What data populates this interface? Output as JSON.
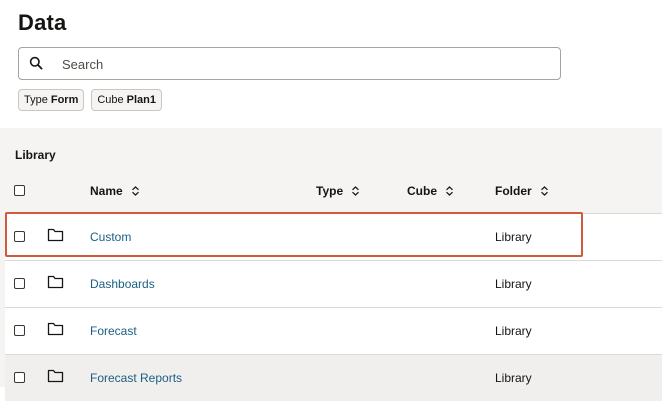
{
  "header": {
    "title": "Data",
    "search": {
      "placeholder": "Search",
      "value": ""
    },
    "filters": [
      {
        "key": "Type",
        "value": "Form"
      },
      {
        "key": "Cube",
        "value": "Plan1"
      }
    ]
  },
  "list": {
    "section_label": "Library",
    "columns": {
      "name": "Name",
      "type": "Type",
      "cube": "Cube",
      "folder": "Folder"
    },
    "rows": [
      {
        "name": "Custom",
        "type": "",
        "cube": "",
        "folder": "Library",
        "icon": "folder-icon"
      },
      {
        "name": "Dashboards",
        "type": "",
        "cube": "",
        "folder": "Library",
        "icon": "folder-icon"
      },
      {
        "name": "Forecast",
        "type": "",
        "cube": "",
        "folder": "Library",
        "icon": "folder-icon"
      },
      {
        "name": "Forecast Reports",
        "type": "",
        "cube": "",
        "folder": "Library",
        "icon": "folder-icon"
      }
    ]
  },
  "colors": {
    "link": "#1a5f83",
    "highlight": "#cf5a3c",
    "panel_bg": "#f5f4f2"
  }
}
